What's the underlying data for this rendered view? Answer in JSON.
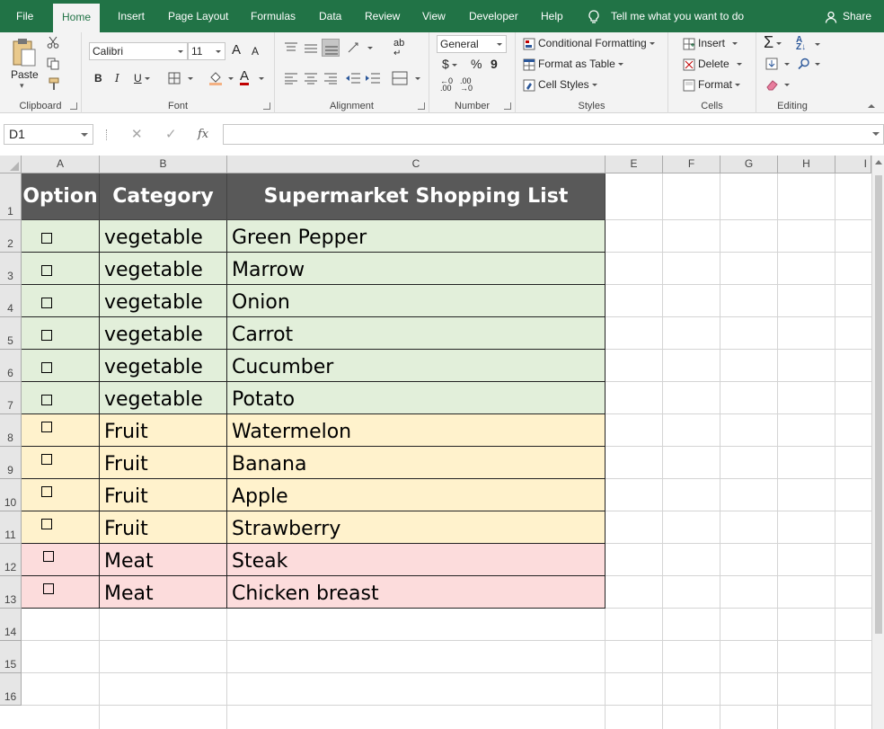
{
  "ribbon_tabs": [
    {
      "label": "File"
    },
    {
      "label": "Home",
      "active": true
    },
    {
      "label": "Insert"
    },
    {
      "label": "Page Layout"
    },
    {
      "label": "Formulas"
    },
    {
      "label": "Data"
    },
    {
      "label": "Review"
    },
    {
      "label": "View"
    },
    {
      "label": "Developer"
    },
    {
      "label": "Help"
    }
  ],
  "tell_me": "Tell me what you want to do",
  "share": "Share",
  "clipboard": {
    "paste": "Paste",
    "label": "Clipboard"
  },
  "font": {
    "name": "Calibri",
    "size": "11",
    "bold": "B",
    "italic": "I",
    "underline": "U",
    "grow": "A",
    "shrink": "A",
    "color_a": "A",
    "label": "Font"
  },
  "alignment": {
    "label": "Alignment",
    "wrap": "ab"
  },
  "number": {
    "format": "General",
    "currency": "$",
    "percent": "%",
    "comma": "9",
    "label": "Number"
  },
  "styles": {
    "conditional": "Conditional Formatting",
    "format_table": "Format as Table",
    "cell_styles": "Cell Styles",
    "label": "Styles"
  },
  "cells": {
    "insert": "Insert",
    "delete": "Delete",
    "format": "Format",
    "label": "Cells"
  },
  "editing": {
    "label": "Editing",
    "sum": "Σ"
  },
  "formula_bar": {
    "name_box": "D1",
    "cancel": "✕",
    "enter": "✓",
    "fx": "fx",
    "value": ""
  },
  "columns": [
    "A",
    "B",
    "C",
    "E",
    "F",
    "G",
    "H",
    "I"
  ],
  "rows": [
    "1",
    "2",
    "3",
    "4",
    "5",
    "6",
    "7",
    "8",
    "9",
    "10",
    "11",
    "12",
    "13",
    "14",
    "15",
    "16"
  ],
  "table": {
    "headers": [
      "Option",
      "Category",
      "Supermarket Shopping List"
    ],
    "rows": [
      {
        "category": "vegetable",
        "item": "Green Pepper",
        "group": "veg"
      },
      {
        "category": "vegetable",
        "item": "Marrow",
        "group": "veg"
      },
      {
        "category": "vegetable",
        "item": "Onion",
        "group": "veg"
      },
      {
        "category": "vegetable",
        "item": "Carrot",
        "group": "veg"
      },
      {
        "category": "vegetable",
        "item": "Cucumber",
        "group": "veg"
      },
      {
        "category": "vegetable",
        "item": "Potato",
        "group": "veg"
      },
      {
        "category": "Fruit",
        "item": "Watermelon",
        "group": "fruit"
      },
      {
        "category": "Fruit",
        "item": "Banana",
        "group": "fruit"
      },
      {
        "category": "Fruit",
        "item": "Apple",
        "group": "fruit"
      },
      {
        "category": "Fruit",
        "item": "Strawberry",
        "group": "fruit"
      },
      {
        "category": "Meat",
        "item": "Steak",
        "group": "meat"
      },
      {
        "category": "Meat",
        "item": "Chicken breast",
        "group": "meat"
      }
    ]
  },
  "colors": {
    "brand_green": "#217346",
    "header_fill": "#595959",
    "veg_fill": "#e2efda",
    "fruit_fill": "#fff2cc",
    "meat_fill": "#fcdcdc"
  }
}
